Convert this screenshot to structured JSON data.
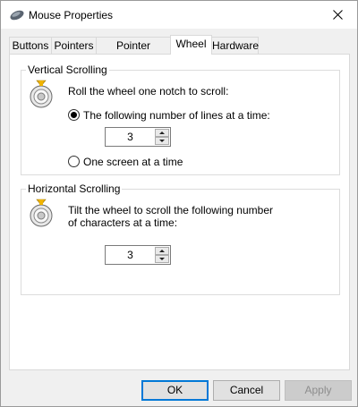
{
  "window": {
    "title": "Mouse Properties",
    "app_icon": "mouse-icon",
    "close_icon": "close-icon"
  },
  "tabs": [
    {
      "label": "Buttons",
      "active": false
    },
    {
      "label": "Pointers",
      "active": false
    },
    {
      "label": "Pointer Options",
      "active": false
    },
    {
      "label": "Wheel",
      "active": true
    },
    {
      "label": "Hardware",
      "active": false
    }
  ],
  "vertical": {
    "legend": "Vertical Scrolling",
    "icon": "scroll-wheel-icon",
    "intro": "Roll the wheel one notch to scroll:",
    "option_lines": {
      "label": "The following number of lines at a time:",
      "selected": true
    },
    "lines_value": "3",
    "option_screen": {
      "label": "One screen at a time",
      "selected": false
    }
  },
  "horizontal": {
    "legend": "Horizontal Scrolling",
    "icon": "scroll-wheel-icon",
    "intro_line1": "Tilt the wheel to scroll the following number",
    "intro_line2": "of characters at a time:",
    "chars_value": "3"
  },
  "buttons": {
    "ok": "OK",
    "cancel": "Cancel",
    "apply": "Apply"
  }
}
